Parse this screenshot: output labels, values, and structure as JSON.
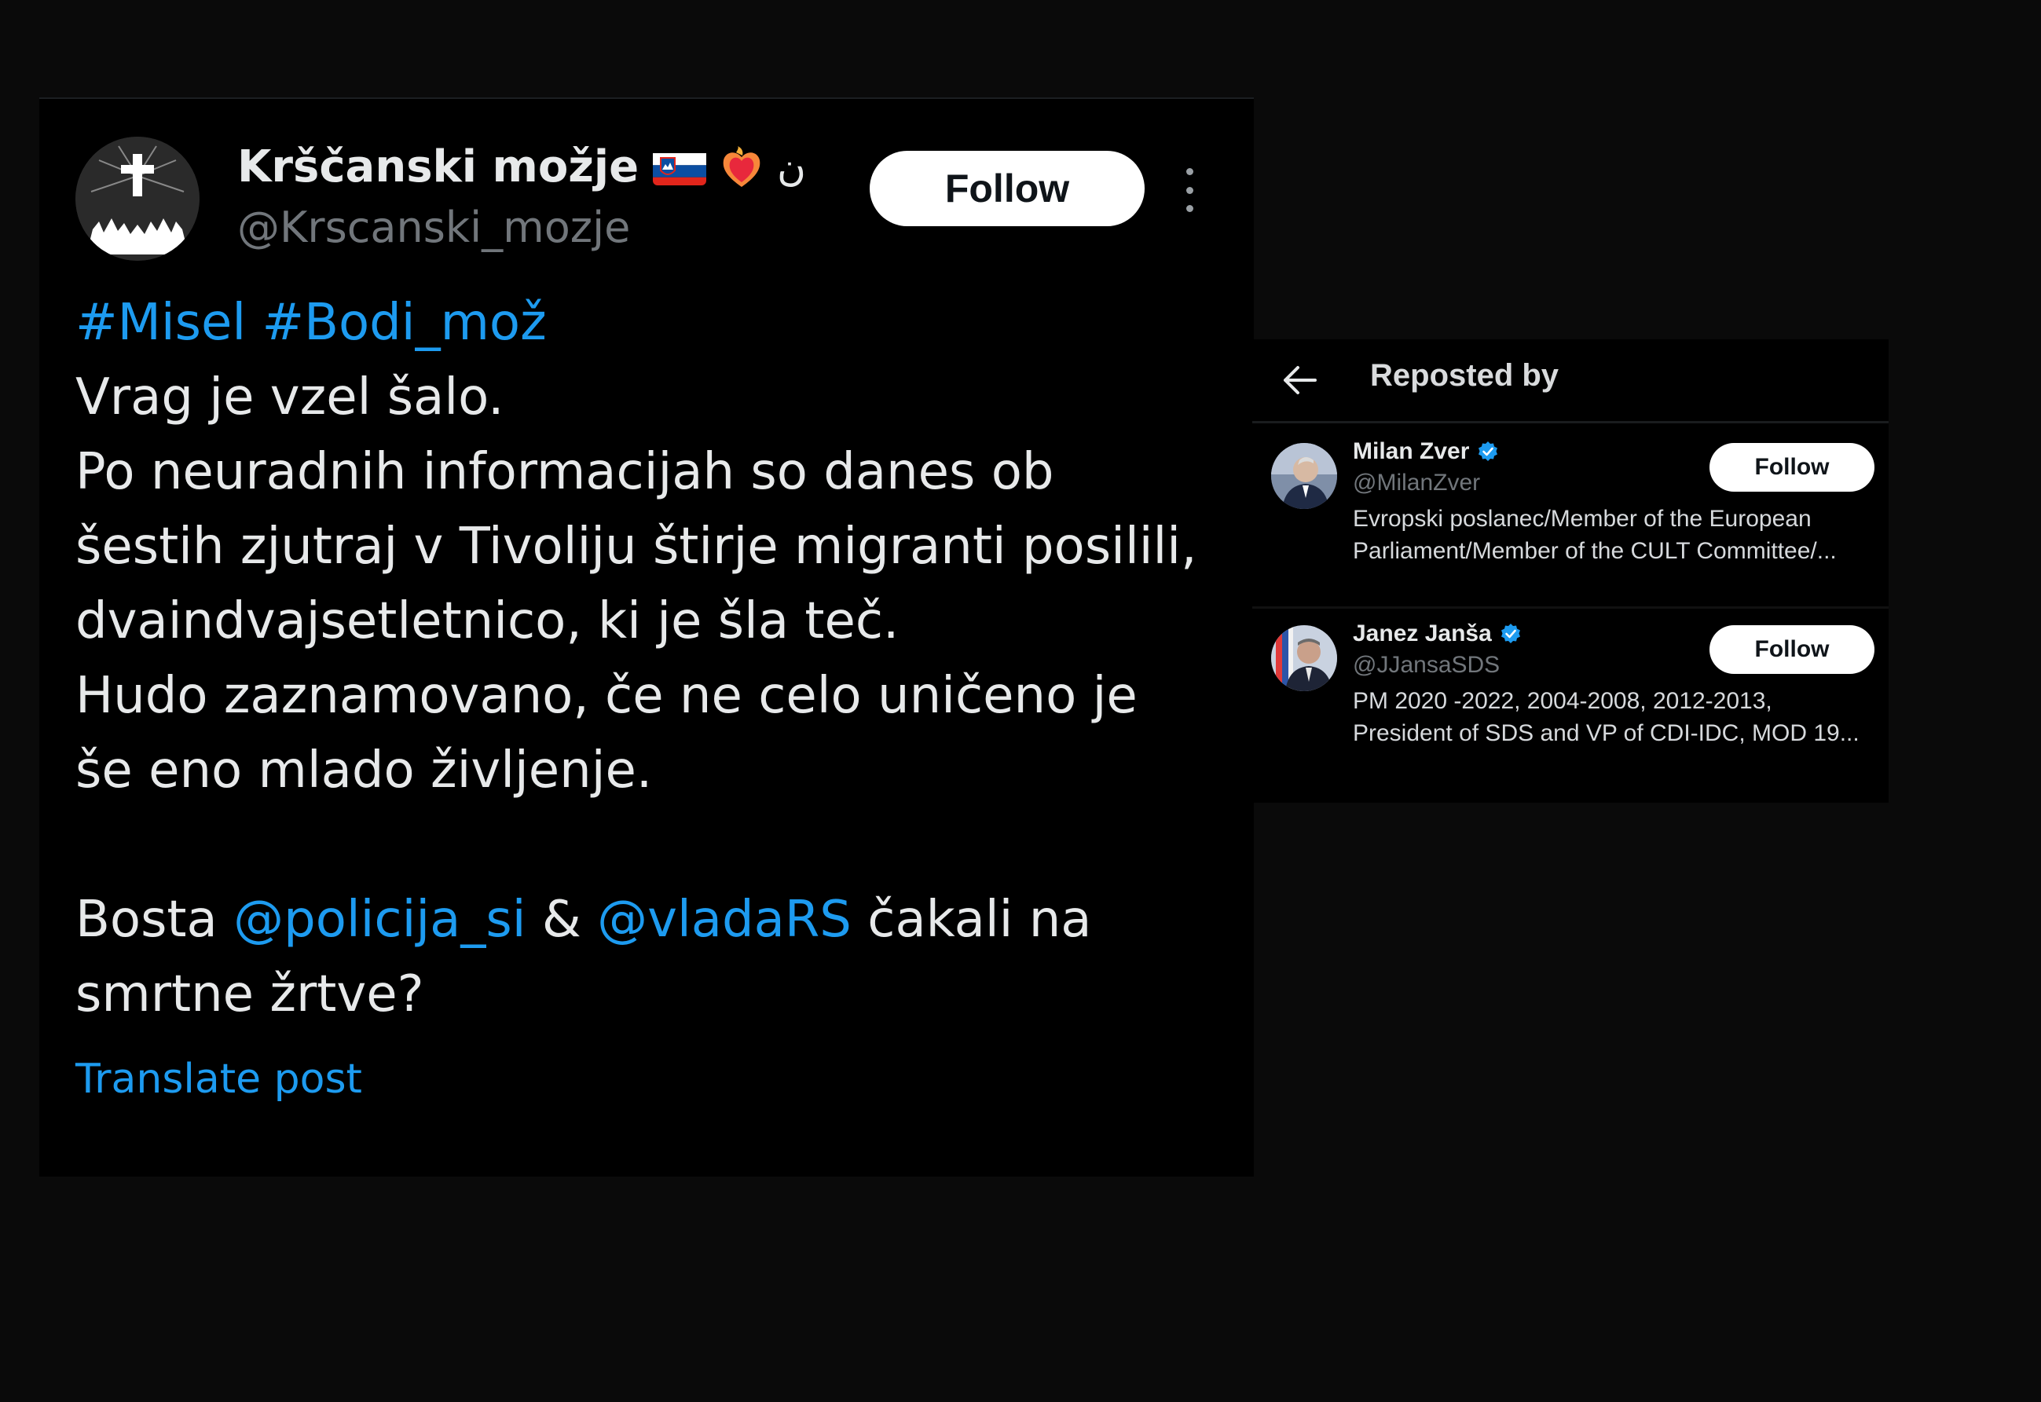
{
  "post": {
    "author": {
      "name": "Krščanski možje",
      "handle": "@Krscanski_mozje",
      "name_suffix": "ن"
    },
    "follow_label": "Follow",
    "hashtags": "#Misel #Bodi_mož",
    "lines": [
      "Vrag je vzel šalo.",
      "Po neuradnih informacijah so danes ob",
      "šestih zjutraj v Tivoliju štirje migranti posilili,",
      "dvaindvajsetletnico, ki je šla teč.",
      "Hudo zaznamovano, če ne celo uničeno je",
      "še eno mlado življenje."
    ],
    "closing": {
      "prefix": "Bosta ",
      "mention1": "@policija_si",
      "amp": " & ",
      "mention2": "@vladaRS",
      "suffix": " čakali na",
      "line2": "smrtne žrtve?"
    },
    "translate_label": "Translate post"
  },
  "reposts": {
    "title": "Reposted by",
    "users": [
      {
        "name": "Milan Zver",
        "handle": "@MilanZver",
        "bio_line1": "Evropski poslanec/Member of the European",
        "bio_line2": "Parliament/Member of the CULT Committee/...",
        "follow_label": "Follow"
      },
      {
        "name": "Janez Janša",
        "handle": "@JJansaSDS",
        "bio_line1": "PM 2020 -2022, 2004-2008, 2012-2013,",
        "bio_line2": "President of SDS and VP of CDI-IDC, MOD 19...",
        "follow_label": "Follow"
      }
    ]
  },
  "colors": {
    "link": "#1d9bf0",
    "verified": "#1d9bf0",
    "background": "#000000"
  },
  "icons": [
    "cross-avatar-icon",
    "slovenia-flag-icon",
    "heart-on-fire-icon",
    "more-options-icon",
    "back-arrow-icon",
    "verified-badge-icon"
  ]
}
